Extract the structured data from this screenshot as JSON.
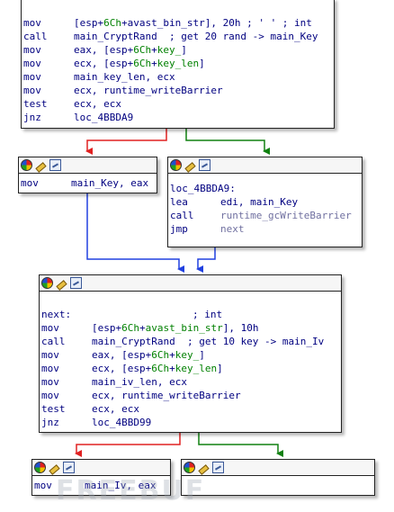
{
  "block1": {
    "lines": [
      {
        "mnem": "mov",
        "ops": [
          {
            "t": "[esp+"
          },
          {
            "t": "6Ch",
            "c": "green"
          },
          {
            "t": "+avast_bin_str], 20h ; ' ' ; int"
          }
        ]
      },
      {
        "mnem": "call",
        "ops": [
          {
            "t": "main_CryptRand  ; get 20 rand -> main_Key"
          }
        ]
      },
      {
        "mnem": "mov",
        "ops": [
          {
            "t": "eax, [esp+"
          },
          {
            "t": "6Ch",
            "c": "green"
          },
          {
            "t": "+"
          },
          {
            "t": "key_",
            "c": "green"
          },
          {
            "t": "]"
          }
        ]
      },
      {
        "mnem": "mov",
        "ops": [
          {
            "t": "ecx, [esp+"
          },
          {
            "t": "6Ch",
            "c": "green"
          },
          {
            "t": "+"
          },
          {
            "t": "key_len",
            "c": "green"
          },
          {
            "t": "]"
          }
        ]
      },
      {
        "mnem": "mov",
        "ops": [
          {
            "t": "main_key_len, ecx"
          }
        ]
      },
      {
        "mnem": "mov",
        "ops": [
          {
            "t": "ecx, runtime_writeBarrier"
          }
        ]
      },
      {
        "mnem": "test",
        "ops": [
          {
            "t": "ecx, ecx"
          }
        ]
      },
      {
        "mnem": "jnz",
        "ops": [
          {
            "t": "loc_4BBDA9"
          }
        ]
      }
    ]
  },
  "block2": {
    "lines": [
      {
        "mnem": "mov",
        "ops": [
          {
            "t": "main_Key, eax"
          }
        ]
      }
    ]
  },
  "block3": {
    "label": "loc_4BBDA9:",
    "lines": [
      {
        "mnem": "lea",
        "ops": [
          {
            "t": "edi, main_Key"
          }
        ]
      },
      {
        "mnem": "call",
        "ops": [
          {
            "t": "runtime_gcWriteBarrier",
            "c": "gray"
          }
        ]
      },
      {
        "mnem": "jmp",
        "ops": [
          {
            "t": "next",
            "c": "gray"
          }
        ]
      }
    ]
  },
  "block4": {
    "label": "next:",
    "label_comment": "; int",
    "lines": [
      {
        "mnem": "mov",
        "ops": [
          {
            "t": "[esp+"
          },
          {
            "t": "6Ch",
            "c": "green"
          },
          {
            "t": "+"
          },
          {
            "t": "avast_bin_str",
            "c": "green"
          },
          {
            "t": "], 10h"
          }
        ]
      },
      {
        "mnem": "call",
        "ops": [
          {
            "t": "main_CryptRand  ; get 10 key -> main_Iv"
          }
        ]
      },
      {
        "mnem": "mov",
        "ops": [
          {
            "t": "eax, [esp+"
          },
          {
            "t": "6Ch",
            "c": "green"
          },
          {
            "t": "+"
          },
          {
            "t": "key_",
            "c": "green"
          },
          {
            "t": "]"
          }
        ]
      },
      {
        "mnem": "mov",
        "ops": [
          {
            "t": "ecx, [esp+"
          },
          {
            "t": "6Ch",
            "c": "green"
          },
          {
            "t": "+"
          },
          {
            "t": "key_len",
            "c": "green"
          },
          {
            "t": "]"
          }
        ]
      },
      {
        "mnem": "mov",
        "ops": [
          {
            "t": "main_iv_len, ecx"
          }
        ]
      },
      {
        "mnem": "mov",
        "ops": [
          {
            "t": "ecx, runtime_writeBarrier"
          }
        ]
      },
      {
        "mnem": "test",
        "ops": [
          {
            "t": "ecx, ecx"
          }
        ]
      },
      {
        "mnem": "jnz",
        "ops": [
          {
            "t": "loc_4BBD99"
          }
        ]
      }
    ]
  },
  "block5": {
    "lines": [
      {
        "mnem": "mov",
        "ops": [
          {
            "t": "main_Iv, eax"
          }
        ]
      }
    ]
  },
  "block6": {
    "lines": []
  },
  "colors": {
    "edge_false": "#e02020",
    "edge_true": "#108010",
    "edge_jump": "#2040e0"
  },
  "header_icons": [
    "color-picker-icon",
    "edit-pen-icon",
    "graph-view-icon"
  ],
  "watermark": "FREEBUF"
}
